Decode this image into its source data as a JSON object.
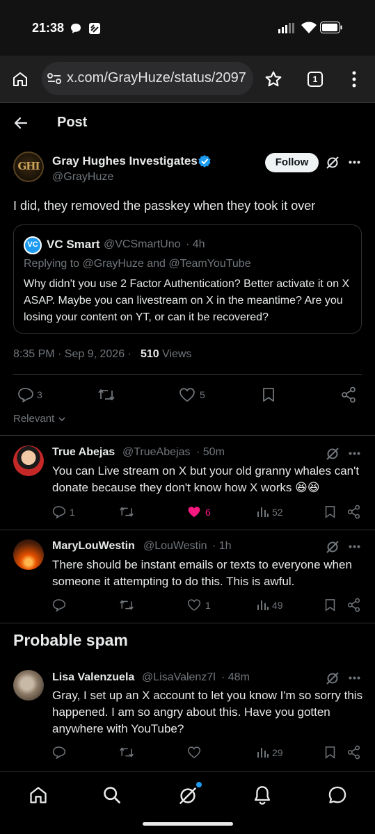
{
  "status_bar": {
    "time": "21:38"
  },
  "browser": {
    "url": "x.com/GrayHuze/status/2097",
    "tab_count": "1"
  },
  "header": {
    "title": "Post"
  },
  "main_post": {
    "author_name": "Gray Hughes Investigates",
    "handle": "@GrayHuze",
    "avatar_text": "GHI",
    "follow_label": "Follow",
    "text": "I did, they removed the passkey when they took it over",
    "quote": {
      "avatar_text": "VC",
      "author_name": "VC Smart",
      "handle": "@VCSmartUno",
      "time": "· 4h",
      "replying_to": "Replying to @GrayHuze and @TeamYouTube",
      "text": "Why didn't you use 2 Factor Authentication? Better activate it on X ASAP. Maybe you can livestream on X in the meantime? Are you losing your content on YT, or can it be recovered?"
    },
    "timestamp": "8:35 PM · Sep 9, 2026 ·",
    "views_count": "510",
    "views_label": "Views",
    "replies": "3",
    "likes": "5"
  },
  "sort_label": "Relevant",
  "replies": [
    {
      "name": "True Abejas",
      "handle": "@TrueAbejas",
      "time": "· 50m",
      "text": "You can Live stream on X but your old granny whales can't donate because they don't know how X works 😆😆",
      "replies": "1",
      "likes": "6",
      "views": "52"
    },
    {
      "name": "MaryLouWestin",
      "handle": "@LouWestin",
      "time": "· 1h",
      "text": "There should be instant emails or texts to everyone when someone it attempting to do this. This is awful.",
      "likes": "1",
      "views": "49"
    }
  ],
  "spam_section": {
    "title": "Probable spam",
    "reply": {
      "name": "Lisa Valenzuela",
      "handle": "@LisaValenz7l",
      "time": "· 48m",
      "text": "Gray, I set up an X account to let you know I'm so sorry this happened. I am so angry about this.  Have you gotten anywhere with YouTube?",
      "views": "29"
    }
  },
  "colors": {
    "background": "#000000",
    "verified": "#1d9bf0",
    "liked": "#f91880",
    "muted": "#71767b",
    "notification_dot": "#1d9bf0"
  }
}
